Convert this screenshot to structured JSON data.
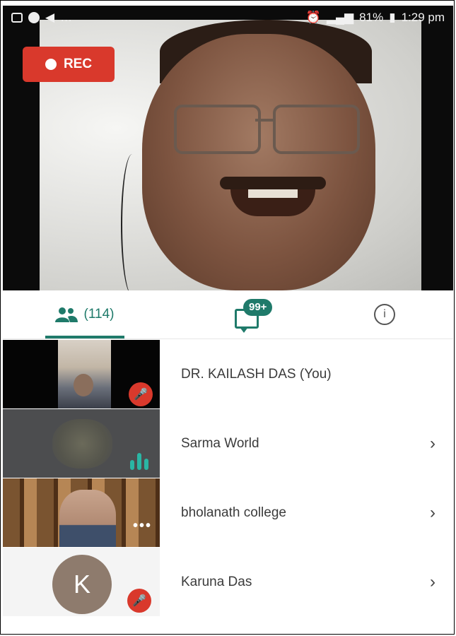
{
  "status_bar": {
    "time": "1:29 pm",
    "battery": "81%"
  },
  "video": {
    "rec_label": "REC"
  },
  "tabs": {
    "participants_count": "(114)",
    "chat_badge": "99+"
  },
  "participants": [
    {
      "name": "DR. KAILASH DAS (You)",
      "has_chevron": false
    },
    {
      "name": "Sarma World",
      "has_chevron": true
    },
    {
      "name": "bholanath college",
      "has_chevron": true
    },
    {
      "name": "Karuna Das",
      "has_chevron": true,
      "avatar_letter": "K"
    }
  ],
  "colors": {
    "accent": "#1f7a6a",
    "rec": "#d9392c",
    "audio": "#2ab6a4"
  }
}
